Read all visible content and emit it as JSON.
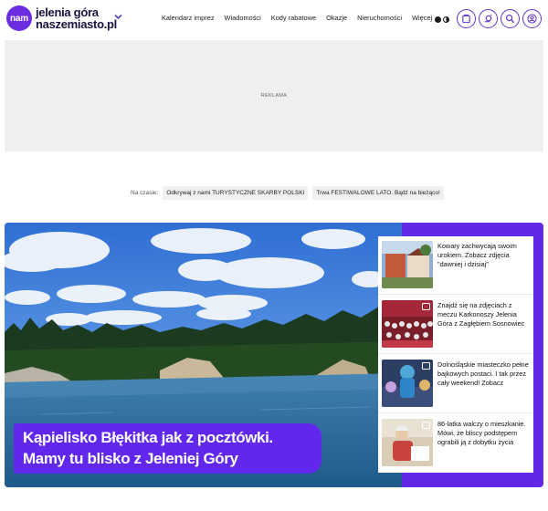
{
  "header": {
    "logo_badge": "nam",
    "logo_line1": "jelenia góra",
    "logo_line2": "naszemiasto.pl",
    "city_menu_icon": "chevron-down-icon"
  },
  "nav": {
    "items": [
      "Kalendarz imprez",
      "Wiadomości",
      "Kody rabatowe",
      "Okazje",
      "Nieruchomości",
      "Więcej"
    ]
  },
  "toolbar_icons": [
    "theme-toggle-icon",
    "newspaper-icon",
    "weather-icon",
    "search-icon",
    "user-icon"
  ],
  "ad": {
    "label": "REKLAMA"
  },
  "trending": {
    "label": "Na czasie:",
    "chips": [
      "Odkrywaj z nami TURYSTYCZNE SKARBY POLSKI",
      "Trwa FESTIWALOWE LATO. Bądź na bieżąco!"
    ]
  },
  "hero": {
    "title": "Kąpielisko Błękitka jak z pocztówki. Mamy tu blisko z Jeleniej Góry"
  },
  "side_articles": [
    {
      "title": "Kowary zachwycają swoim urokiem. Zobacz zdjęcia \"dawniej i dzisiaj\""
    },
    {
      "title": "Znajdź się na zdjęciach z meczu Karkonoszy Jelenia Góra z Zagłębiem Sosnowiec"
    },
    {
      "title": "Dolnośląskie miasteczko pełne bajkowych postaci. I tak przez cały weekend! Zobacz"
    },
    {
      "title": "86-latka walczy o mieszkanie. Mówi, że bliscy podstępem ograbili ją z dobytku życia"
    }
  ],
  "colors": {
    "brand": "#6d2de0",
    "accent": "#6127ec",
    "ad_bg": "#efefef"
  }
}
